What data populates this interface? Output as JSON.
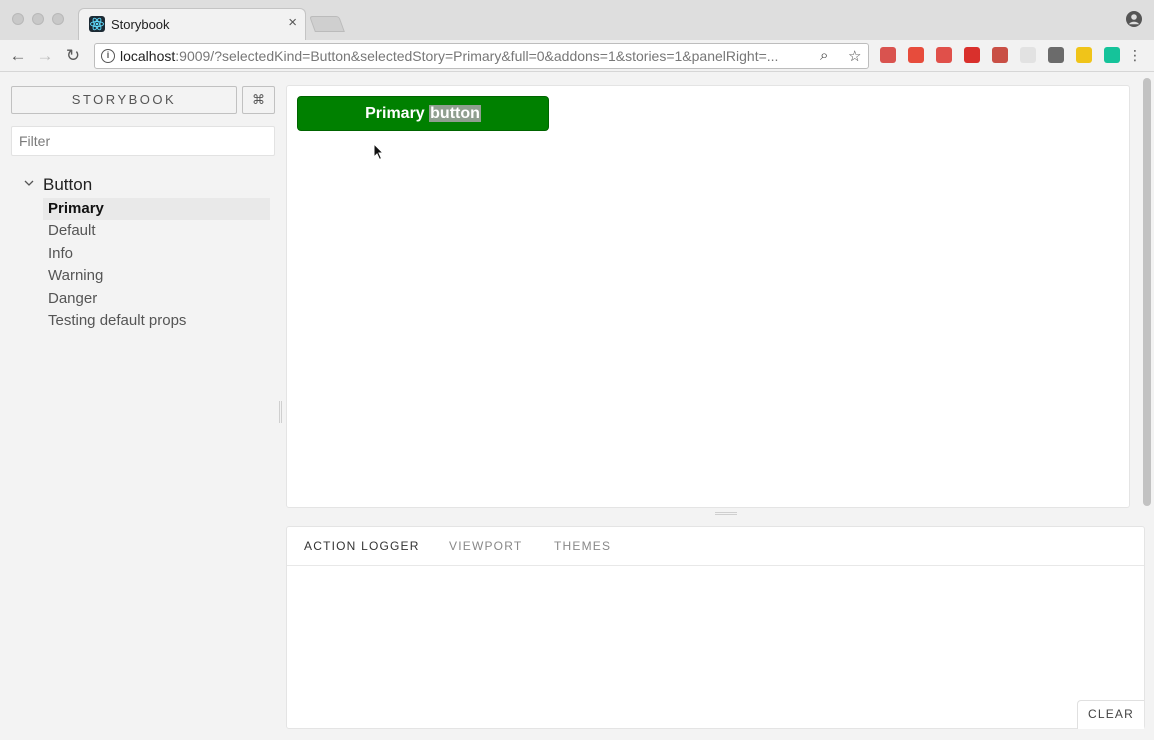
{
  "browser": {
    "tab_title": "Storybook",
    "tab_close": "×",
    "url_host": "localhost",
    "url_rest": ":9009/?selectedKind=Button&selectedStory=Primary&full=0&addons=1&stories=1&panelRight=...",
    "info_glyph": "i",
    "back_glyph": "←",
    "forward_glyph": "→",
    "reload_glyph": "↻",
    "zoom_glyph": "⌕",
    "star_glyph": "☆",
    "menu_glyph": "⋮",
    "extensions": [
      {
        "name": "calendar-ext-icon",
        "color": "#d9534f"
      },
      {
        "name": "opera-ext-icon",
        "color": "#e74c3c"
      },
      {
        "name": "shield-ext-icon",
        "color": "#e0504a"
      },
      {
        "name": "adblock-ext-icon",
        "color": "#d9302c"
      },
      {
        "name": "picture-ext-icon",
        "color": "#c94f45"
      },
      {
        "name": "circle-ext-icon",
        "color": "#e2e2e2"
      },
      {
        "name": "evernote-ext-icon",
        "color": "#6b6b6b"
      },
      {
        "name": "moon-ext-icon",
        "color": "#f0c419"
      },
      {
        "name": "grammarly-ext-icon",
        "color": "#15c39a"
      }
    ]
  },
  "storybook": {
    "title": "STORYBOOK",
    "shortcut_glyph": "⌘",
    "filter_placeholder": "Filter",
    "kind": "Button",
    "stories": [
      "Primary",
      "Default",
      "Info",
      "Warning",
      "Danger",
      "Testing default props"
    ],
    "selected_story": "Primary",
    "preview_button": {
      "text_before": "Primary",
      "text_selected": "button",
      "color": "#008000"
    },
    "addon_tabs": [
      "ACTION LOGGER",
      "VIEWPORT",
      "THEMES"
    ],
    "active_addon_tab": "ACTION LOGGER",
    "clear_label": "CLEAR"
  }
}
